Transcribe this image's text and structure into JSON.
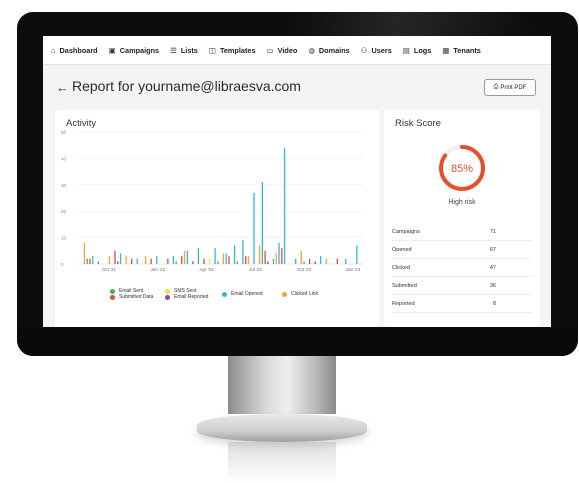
{
  "nav": {
    "items": [
      {
        "label": "Dashboard",
        "icon": "home-icon",
        "glyph": "⌂"
      },
      {
        "label": "Campaigns",
        "icon": "briefcase-icon",
        "glyph": "▣"
      },
      {
        "label": "Lists",
        "icon": "list-icon",
        "glyph": "☰"
      },
      {
        "label": "Templates",
        "icon": "template-icon",
        "glyph": "◫"
      },
      {
        "label": "Video",
        "icon": "video-icon",
        "glyph": "▭"
      },
      {
        "label": "Domains",
        "icon": "globe-icon",
        "glyph": "◍"
      },
      {
        "label": "Users",
        "icon": "users-icon",
        "glyph": "⚇"
      },
      {
        "label": "Logs",
        "icon": "document-icon",
        "glyph": "▤"
      },
      {
        "label": "Tenants",
        "icon": "building-icon",
        "glyph": "▦"
      }
    ]
  },
  "header": {
    "back_glyph": "←",
    "title": "Report for yourname@libraesva.com",
    "print_label": "Print PDF",
    "print_icon": "printer-icon"
  },
  "activity": {
    "title": "Activity"
  },
  "risk": {
    "title": "Risk Score",
    "percent_text": "85%",
    "percent": 85,
    "level": "High risk",
    "color": "#e8502c",
    "stats": [
      {
        "label": "Campaigns",
        "value": "71"
      },
      {
        "label": "Opened",
        "value": "67"
      },
      {
        "label": "Clicked",
        "value": "47"
      },
      {
        "label": "Submitted",
        "value": "36"
      },
      {
        "label": "Reported",
        "value": "8"
      }
    ]
  },
  "chart_data": {
    "type": "bar",
    "title": "Activity",
    "xlabel": "",
    "ylabel": "",
    "ylim": [
      0,
      50
    ],
    "yticks": [
      "0",
      "10",
      "20",
      "30",
      "40",
      "50"
    ],
    "xticks": [
      "Oct '21",
      "Jan '22",
      "Apr '22",
      "Jul '22",
      "Oct '22",
      "Jan '23"
    ],
    "grid": true,
    "legend_position": "bottom",
    "series": [
      {
        "name": "Email Sent",
        "color": "#4caf50",
        "points": [
          [
            0.02,
            2
          ],
          [
            0.06,
            1
          ],
          [
            0.34,
            1
          ],
          [
            0.49,
            1
          ],
          [
            0.56,
            1
          ],
          [
            0.8,
            1
          ]
        ]
      },
      {
        "name": "SMS Sent",
        "color": "#e6e64a",
        "points": [
          [
            0.27,
            1
          ],
          [
            0.46,
            2
          ],
          [
            0.71,
            1
          ]
        ]
      },
      {
        "name": "Email Opened",
        "color": "#35b6d8",
        "points": [
          [
            0.04,
            3
          ],
          [
            0.14,
            4
          ],
          [
            0.2,
            2
          ],
          [
            0.27,
            3
          ],
          [
            0.33,
            3
          ],
          [
            0.38,
            5
          ],
          [
            0.42,
            6
          ],
          [
            0.48,
            6
          ],
          [
            0.52,
            4
          ],
          [
            0.55,
            7
          ],
          [
            0.58,
            9
          ],
          [
            0.62,
            27
          ],
          [
            0.65,
            31
          ],
          [
            0.69,
            2
          ],
          [
            0.71,
            8
          ],
          [
            0.73,
            44
          ],
          [
            0.77,
            2
          ],
          [
            0.86,
            3
          ],
          [
            0.95,
            2
          ],
          [
            0.99,
            7
          ]
        ]
      },
      {
        "name": "Clicked Link",
        "color": "#f4a23a",
        "points": [
          [
            0.01,
            8
          ],
          [
            0.1,
            3
          ],
          [
            0.16,
            3
          ],
          [
            0.23,
            3
          ],
          [
            0.37,
            5
          ],
          [
            0.51,
            4
          ],
          [
            0.6,
            3
          ],
          [
            0.64,
            7
          ],
          [
            0.7,
            4
          ],
          [
            0.79,
            5
          ],
          [
            0.88,
            2
          ]
        ]
      },
      {
        "name": "Submitted Data",
        "color": "#e14a35",
        "points": [
          [
            0.03,
            2
          ],
          [
            0.12,
            5
          ],
          [
            0.18,
            2
          ],
          [
            0.25,
            2
          ],
          [
            0.31,
            2
          ],
          [
            0.36,
            3
          ],
          [
            0.44,
            2
          ],
          [
            0.53,
            3
          ],
          [
            0.59,
            3
          ],
          [
            0.66,
            5
          ],
          [
            0.72,
            6
          ],
          [
            0.82,
            2
          ],
          [
            0.92,
            2
          ]
        ]
      },
      {
        "name": "Email Reported",
        "color": "#8e44ad",
        "points": [
          [
            0.13,
            1
          ],
          [
            0.4,
            1
          ],
          [
            0.67,
            1
          ],
          [
            0.84,
            1
          ]
        ]
      }
    ]
  }
}
